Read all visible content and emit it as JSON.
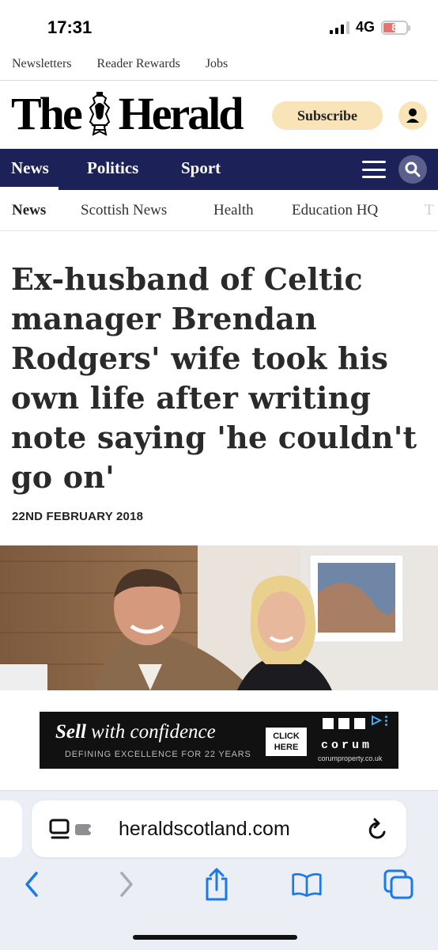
{
  "status_bar": {
    "time": "17:31",
    "network": "4G",
    "battery": "8"
  },
  "utility_links": [
    "Newsletters",
    "Reader Rewards",
    "Jobs"
  ],
  "masthead": {
    "logo_left": "The",
    "logo_right": "Herald",
    "subscribe_label": "Subscribe"
  },
  "primary_nav": {
    "items": [
      "News",
      "Politics",
      "Sport"
    ],
    "active": "News"
  },
  "secondary_nav": {
    "items": [
      "News",
      "Scottish News",
      "Health",
      "Education HQ",
      "T"
    ]
  },
  "article": {
    "headline": "Ex-husband of Celtic manager Brendan Rodgers' wife took his own life after writing note saying 'he couldn't go on'",
    "date": "22ND FEBRUARY 2018"
  },
  "ad": {
    "headline_word": "Sell",
    "headline_rest": " with confidence",
    "tagline": "DEFINING EXCELLENCE FOR 22 YEARS",
    "cta_line1": "CLICK",
    "cta_line2": "HERE",
    "brand": "corum",
    "brand_url": "corumproperty.co.uk"
  },
  "browser": {
    "url": "heraldscotland.com",
    "accent_color": "#1a7be8"
  },
  "colors": {
    "nav_bg": "#1c2157",
    "subscribe_bg": "#f9e3b8"
  }
}
